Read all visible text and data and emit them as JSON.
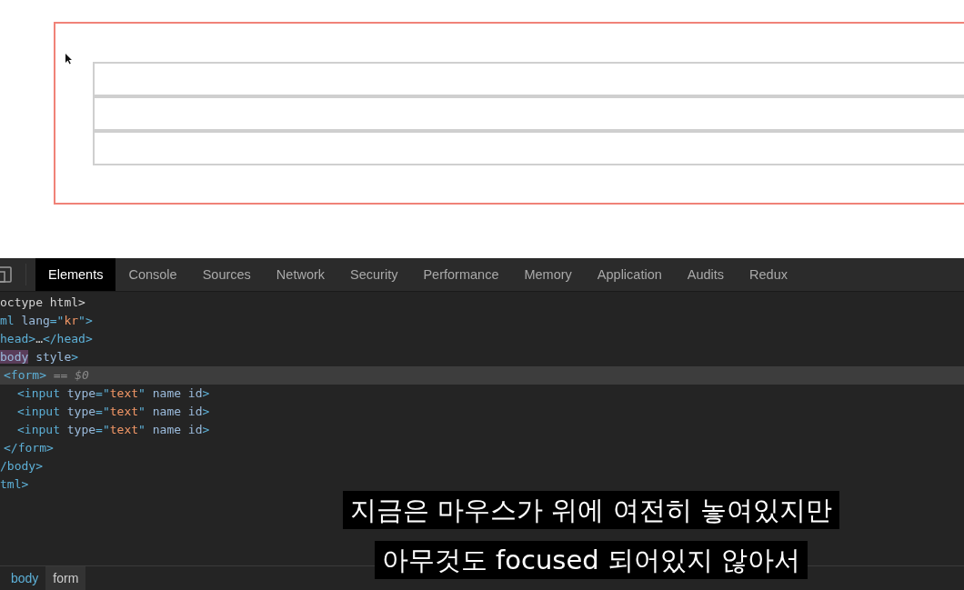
{
  "page": {
    "inputs": [
      {
        "focused": false
      },
      {
        "focused": false
      },
      {
        "focused": false
      }
    ]
  },
  "devtools": {
    "tabs": [
      {
        "label": "Elements",
        "selected": true
      },
      {
        "label": "Console",
        "selected": false
      },
      {
        "label": "Sources",
        "selected": false
      },
      {
        "label": "Network",
        "selected": false
      },
      {
        "label": "Security",
        "selected": false
      },
      {
        "label": "Performance",
        "selected": false
      },
      {
        "label": "Memory",
        "selected": false
      },
      {
        "label": "Application",
        "selected": false
      },
      {
        "label": "Audits",
        "selected": false
      },
      {
        "label": "Redux",
        "selected": false
      }
    ],
    "dom_tree": [
      {
        "selected": false,
        "tokens": [
          {
            "text": "octype html>",
            "kind": "plain"
          }
        ]
      },
      {
        "selected": false,
        "tokens": [
          {
            "text": "ml ",
            "kind": "tag"
          },
          {
            "text": "lang",
            "kind": "attr"
          },
          {
            "text": "=\"",
            "kind": "tag"
          },
          {
            "text": "kr",
            "kind": "value"
          },
          {
            "text": "\">",
            "kind": "tag"
          }
        ]
      },
      {
        "selected": false,
        "tokens": [
          {
            "text": "head>",
            "kind": "tag"
          },
          {
            "text": "…",
            "kind": "plain"
          },
          {
            "text": "</head>",
            "kind": "tag"
          }
        ]
      },
      {
        "selected": false,
        "tokens": [
          {
            "text": "body",
            "kind": "highlight"
          },
          {
            "text": " style",
            "kind": "attr"
          },
          {
            "text": ">",
            "kind": "tag"
          }
        ],
        "children": [
          {
            "selected": true,
            "tokens": [
              {
                "text": "<form>",
                "kind": "tag"
              },
              {
                "text": " == $0",
                "kind": "comment"
              }
            ],
            "children": [
              {
                "selected": false,
                "tokens": [
                  {
                    "text": "<input ",
                    "kind": "tag"
                  },
                  {
                    "text": "type",
                    "kind": "attr"
                  },
                  {
                    "text": "=\"",
                    "kind": "tag"
                  },
                  {
                    "text": "text",
                    "kind": "value"
                  },
                  {
                    "text": "\" ",
                    "kind": "tag"
                  },
                  {
                    "text": "name id",
                    "kind": "attr"
                  },
                  {
                    "text": ">",
                    "kind": "tag"
                  }
                ]
              },
              {
                "selected": false,
                "tokens": [
                  {
                    "text": "<input ",
                    "kind": "tag"
                  },
                  {
                    "text": "type",
                    "kind": "attr"
                  },
                  {
                    "text": "=\"",
                    "kind": "tag"
                  },
                  {
                    "text": "text",
                    "kind": "value"
                  },
                  {
                    "text": "\" ",
                    "kind": "tag"
                  },
                  {
                    "text": "name id",
                    "kind": "attr"
                  },
                  {
                    "text": ">",
                    "kind": "tag"
                  }
                ]
              },
              {
                "selected": false,
                "tokens": [
                  {
                    "text": "<input ",
                    "kind": "tag"
                  },
                  {
                    "text": "type",
                    "kind": "attr"
                  },
                  {
                    "text": "=\"",
                    "kind": "tag"
                  },
                  {
                    "text": "text",
                    "kind": "value"
                  },
                  {
                    "text": "\" ",
                    "kind": "tag"
                  },
                  {
                    "text": "name id",
                    "kind": "attr"
                  },
                  {
                    "text": ">",
                    "kind": "tag"
                  }
                ]
              }
            ]
          },
          {
            "selected": false,
            "tokens": [
              {
                "text": "</form>",
                "kind": "tag"
              }
            ]
          }
        ]
      },
      {
        "selected": false,
        "tokens": [
          {
            "text": "/body>",
            "kind": "tag"
          }
        ]
      },
      {
        "selected": false,
        "tokens": [
          {
            "text": "tml>",
            "kind": "tag"
          }
        ]
      }
    ],
    "breadcrumbs": [
      {
        "label": "body",
        "selected": false
      },
      {
        "label": "form",
        "selected": true
      }
    ]
  },
  "subtitles": [
    "지금은 마우스가 위에 여전히 놓여있지만",
    "아무것도 focused 되어있지 않아서"
  ]
}
